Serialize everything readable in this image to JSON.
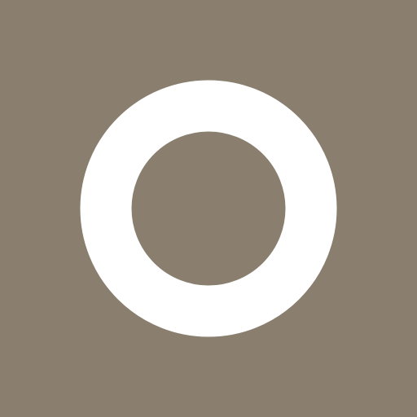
{
  "colors": {
    "background": "#8a7f6f",
    "ring": "#ffffff"
  },
  "icon": {
    "name": "ring-icon",
    "shape": "ring"
  }
}
